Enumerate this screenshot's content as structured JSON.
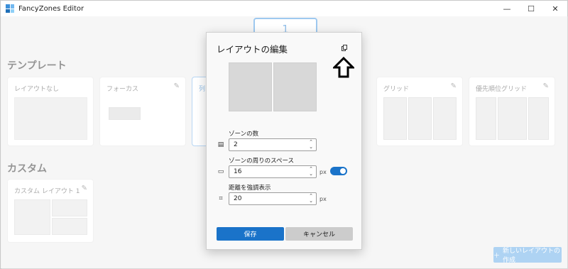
{
  "window": {
    "title": "FancyZones Editor",
    "min": "—",
    "max": "☐",
    "close": "✕"
  },
  "monitor": {
    "label": "1"
  },
  "templates": {
    "title": "テンプレート",
    "items": [
      {
        "label": "レイアウトなし"
      },
      {
        "label": "フォーカス"
      },
      {
        "label": "列"
      },
      {
        "label": "グリッド"
      },
      {
        "label": "優先順位グリッド"
      }
    ]
  },
  "custom": {
    "title": "カスタム",
    "items": [
      {
        "label": "カスタム レイアウト 1"
      }
    ]
  },
  "new_layout": {
    "label": "新しいレイアウトの作成"
  },
  "dialog": {
    "title": "レイアウトの編集",
    "zone_count": {
      "label": "ゾーンの数",
      "value": "2"
    },
    "spacing": {
      "label": "ゾーンの周りのスペース",
      "value": "16",
      "unit": "px",
      "enabled": true
    },
    "highlight": {
      "label": "距離を強調表示",
      "value": "20",
      "unit": "px"
    },
    "save": "保存",
    "cancel": "キャンセル"
  },
  "colors": {
    "accent": "#1a73c9",
    "accent_light": "#8fc3ef"
  }
}
